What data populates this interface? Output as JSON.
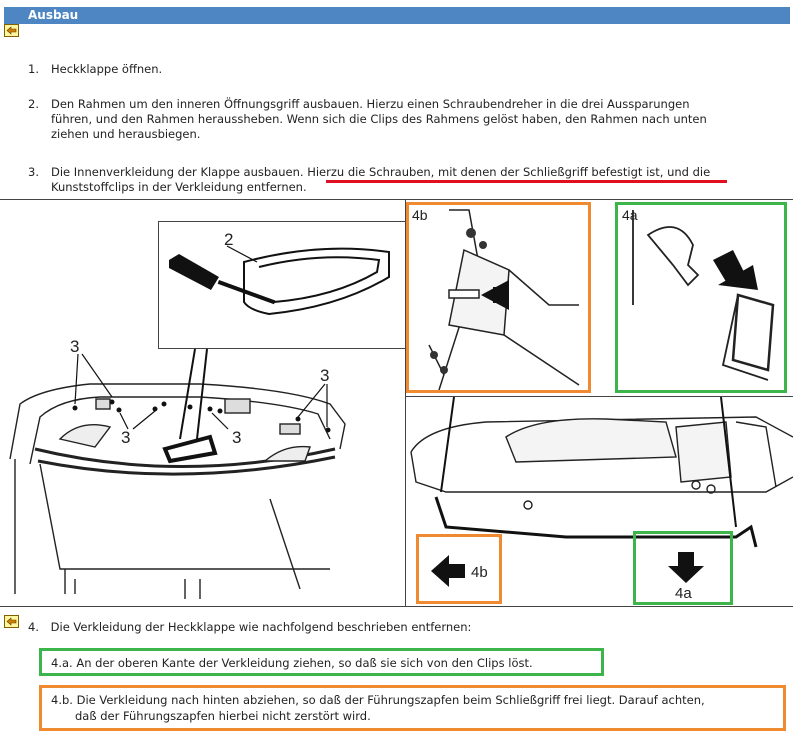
{
  "header": {
    "title": "Ausbau"
  },
  "steps": [
    {
      "num": "1.",
      "lines": [
        "Heckklappe öffnen."
      ]
    },
    {
      "num": "2.",
      "lines": [
        "Den Rahmen um den inneren Öffnungsgriff ausbauen. Hierzu einen Schraubendreher in die drei Aussparungen",
        "führen, und den Rahmen heraussheben. Wenn sich die Clips des Rahmens gelöst haben, den Rahmen nach unten",
        "ziehen und herausbiegen."
      ]
    },
    {
      "num": "3.",
      "lines": [
        "Die Innenverkleidung der Klappe ausbauen. Hierzu die Schrauben, mit denen der Schließgriff befestigt ist, und die",
        "Kunststoffclips in der Verkleidung entfernen."
      ]
    }
  ],
  "figure_labels": {
    "l2": "2",
    "l3a": "3",
    "l3b": "3",
    "l3c": "3",
    "l3d": "3",
    "l4b_top": "4b",
    "l4a_top": "4a",
    "l4b_bottom": "4b",
    "l4a_bottom": "4a"
  },
  "step4": {
    "num": "4.",
    "text": "Die Verkleidung der Heckklappe wie nachfolgend beschrieben entfernen:"
  },
  "note_a": {
    "lines": [
      "4.a. An der oberen Kante der Verkleidung ziehen, so daß sie sich von den Clips löst."
    ]
  },
  "note_b": {
    "lines": [
      "4.b. Die Verkleidung nach hinten abziehen, so daß der Führungszapfen beim Schließgriff frei liegt. Darauf achten,",
      "daß der Führungszapfen hierbei nicht zerstört wird."
    ]
  },
  "colors": {
    "header": "#4e86c4",
    "orange": "#f08a30",
    "green": "#3cb54a",
    "red": "#e01020"
  }
}
